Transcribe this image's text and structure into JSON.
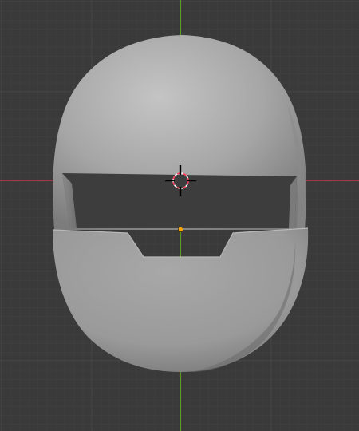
{
  "viewport": {
    "view": "front-orthographic",
    "background_color": "#3a3a3a",
    "grid_minor_color": "#414141",
    "grid_major_color": "#4a4a4a",
    "axis_x_color": "#ff3352",
    "axis_z_color": "#5a9c1e"
  },
  "object": {
    "name_icon": "helmet-mesh",
    "shading": "solid",
    "base_color": "#a3a3a3",
    "visor_opening_color": "#3a3a3a"
  },
  "cursor_3d": {
    "icon": "3d-cursor-icon",
    "ring_colors": [
      "#ff3352",
      "#ffffff"
    ]
  },
  "origin": {
    "icon": "origin-dot-icon",
    "color": "#ffa500"
  }
}
